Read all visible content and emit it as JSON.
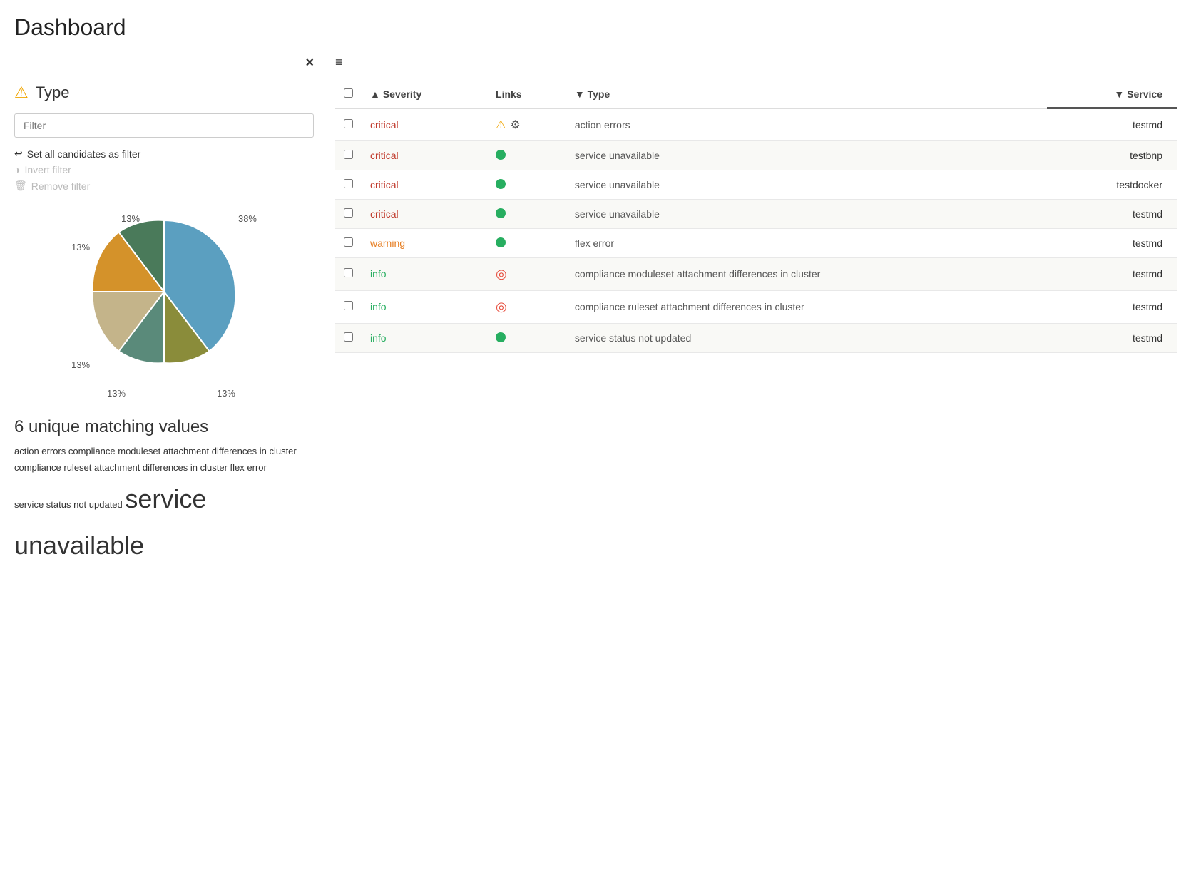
{
  "page": {
    "title": "Dashboard"
  },
  "sidebar": {
    "close_label": "×",
    "type_label": "Type",
    "filter_placeholder": "Filter",
    "actions": [
      {
        "id": "set-candidates",
        "label": "Set all candidates as filter",
        "icon": "arrow-back",
        "disabled": false
      },
      {
        "id": "invert-filter",
        "label": "Invert filter",
        "icon": "circle",
        "disabled": true
      },
      {
        "id": "remove-filter",
        "label": "Remove filter",
        "icon": "trash",
        "disabled": true
      }
    ],
    "pie_labels": [
      {
        "value": "38%",
        "angle": "right"
      },
      {
        "value": "13%",
        "angle": "top"
      },
      {
        "value": "13%",
        "angle": "top-left"
      },
      {
        "value": "13%",
        "angle": "left"
      },
      {
        "value": "13%",
        "angle": "bottom-left"
      },
      {
        "value": "13%",
        "angle": "bottom"
      }
    ],
    "unique_count": "6 unique matching values",
    "tags": [
      {
        "text": "action errors",
        "size": "small"
      },
      {
        "text": "compliance moduleset attachment differences in cluster",
        "size": "small"
      },
      {
        "text": "compliance ruleset attachment differences in cluster",
        "size": "small"
      },
      {
        "text": "flex error",
        "size": "small"
      },
      {
        "text": "service status not updated",
        "size": "small"
      },
      {
        "text": "service unavailable",
        "size": "xlarge"
      }
    ]
  },
  "table": {
    "toolbar_icon": "≡",
    "columns": [
      {
        "id": "checkbox",
        "label": ""
      },
      {
        "id": "severity",
        "label": "Severity",
        "sort": "asc"
      },
      {
        "id": "links",
        "label": "Links"
      },
      {
        "id": "type",
        "label": "Type",
        "sort": "desc"
      },
      {
        "id": "service",
        "label": "Service",
        "sort": "desc"
      }
    ],
    "rows": [
      {
        "id": 1,
        "severity": "critical",
        "severity_class": "critical",
        "links": [
          {
            "type": "warn-icon"
          },
          {
            "type": "gear-icon"
          }
        ],
        "type": "action errors",
        "service": "testmd"
      },
      {
        "id": 2,
        "severity": "critical",
        "severity_class": "critical",
        "links": [
          {
            "type": "green-dot"
          }
        ],
        "type": "service unavailable",
        "service": "testbnp"
      },
      {
        "id": 3,
        "severity": "critical",
        "severity_class": "critical",
        "links": [
          {
            "type": "green-dot"
          }
        ],
        "type": "service unavailable",
        "service": "testdocker"
      },
      {
        "id": 4,
        "severity": "critical",
        "severity_class": "critical",
        "links": [
          {
            "type": "green-dot"
          }
        ],
        "type": "service unavailable",
        "service": "testmd"
      },
      {
        "id": 5,
        "severity": "warning",
        "severity_class": "warning",
        "links": [
          {
            "type": "green-dot"
          }
        ],
        "type": "flex error",
        "service": "testmd"
      },
      {
        "id": 6,
        "severity": "info",
        "severity_class": "info",
        "links": [
          {
            "type": "target-icon"
          }
        ],
        "type": "compliance moduleset attachment differences in cluster",
        "service": "testmd"
      },
      {
        "id": 7,
        "severity": "info",
        "severity_class": "info",
        "links": [
          {
            "type": "target-icon"
          }
        ],
        "type": "compliance ruleset attachment differences in cluster",
        "service": "testmd"
      },
      {
        "id": 8,
        "severity": "info",
        "severity_class": "info",
        "links": [
          {
            "type": "green-dot"
          }
        ],
        "type": "service status not updated",
        "service": "testmd"
      }
    ]
  },
  "colors": {
    "critical": "#c0392b",
    "warning": "#e67e22",
    "info": "#27ae60",
    "pie_blue": "#5b9fc0",
    "pie_olive": "#8a8c3a",
    "pie_teal": "#5a8a7a",
    "pie_tan": "#b8a87a",
    "pie_orange": "#d4922a",
    "pie_green": "#4a7a5a"
  }
}
